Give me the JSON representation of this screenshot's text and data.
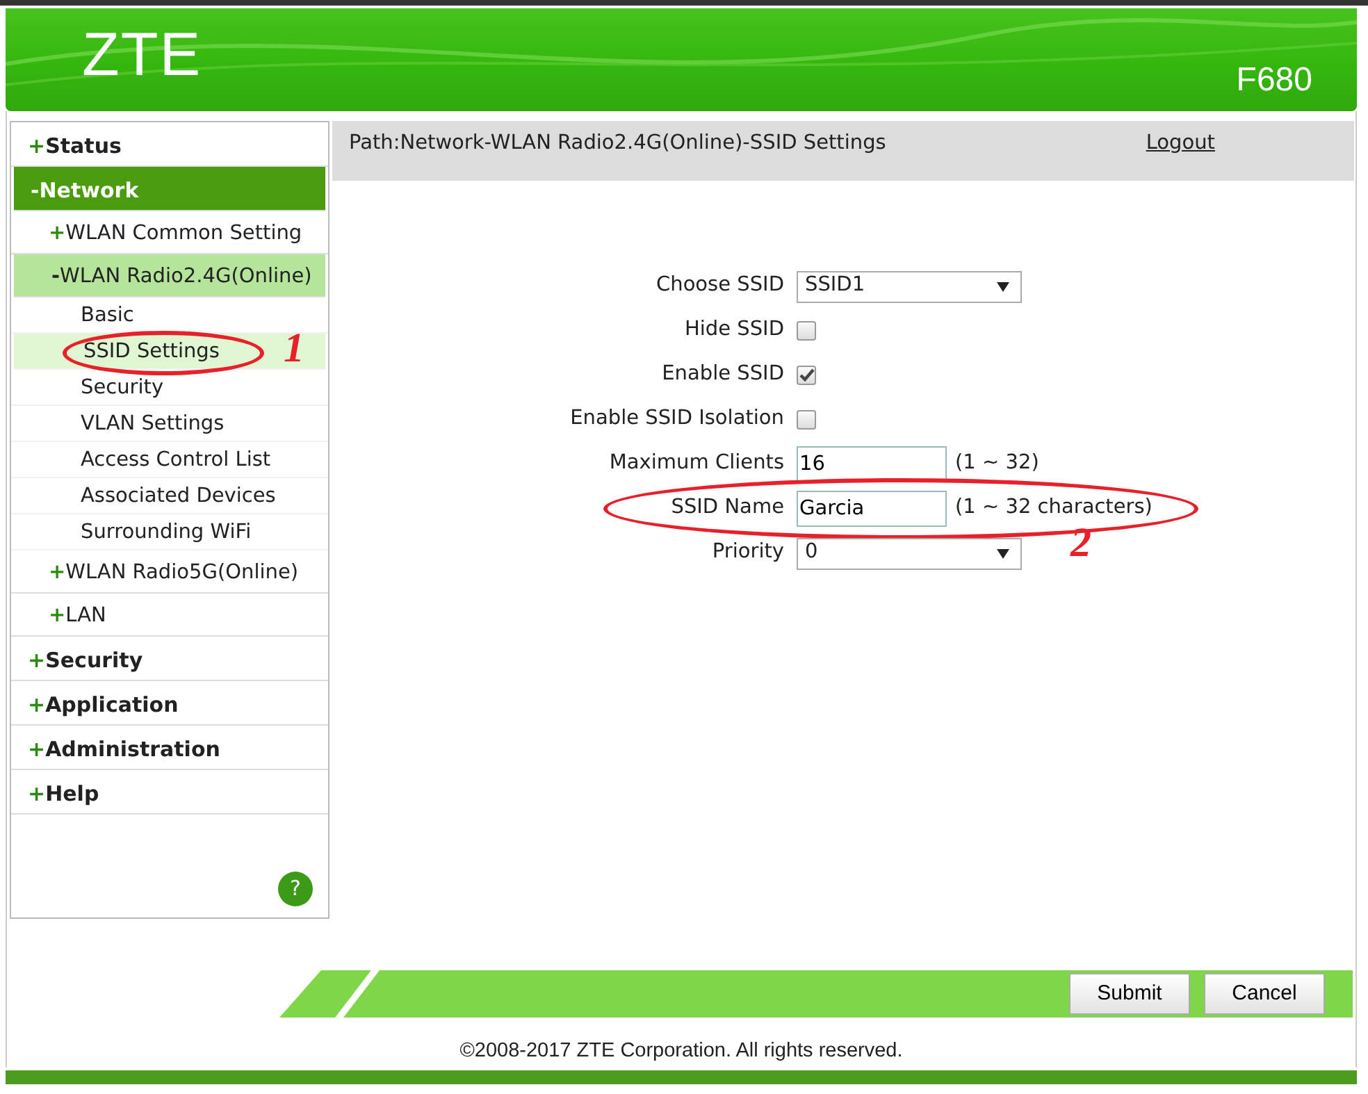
{
  "header": {
    "logo": "ZTE",
    "model": "F680"
  },
  "menu": [
    {
      "toggle": "+",
      "label": "Status",
      "selected": false
    },
    {
      "toggle": "-",
      "label": "Network",
      "selected": true,
      "children": [
        {
          "toggle": "+",
          "label": "WLAN Common Setting",
          "selected": false
        },
        {
          "toggle": "-",
          "label": "WLAN Radio2.4G(Online)",
          "selected": true,
          "children": [
            {
              "label": "Basic",
              "selected": false
            },
            {
              "label": "SSID Settings",
              "selected": true,
              "circled": true,
              "annotation": "1"
            },
            {
              "label": "Security",
              "selected": false
            },
            {
              "label": "VLAN Settings",
              "selected": false
            },
            {
              "label": "Access Control List",
              "selected": false
            },
            {
              "label": "Associated Devices",
              "selected": false
            },
            {
              "label": "Surrounding WiFi",
              "selected": false
            }
          ]
        },
        {
          "toggle": "+",
          "label": "WLAN Radio5G(Online)",
          "selected": false
        },
        {
          "toggle": "+",
          "label": "LAN",
          "selected": false
        }
      ]
    },
    {
      "toggle": "+",
      "label": "Security",
      "selected": false
    },
    {
      "toggle": "+",
      "label": "Application",
      "selected": false
    },
    {
      "toggle": "+",
      "label": "Administration",
      "selected": false
    },
    {
      "toggle": "+",
      "label": "Help",
      "selected": false
    }
  ],
  "help_button": "?",
  "path": "Path:Network-WLAN Radio2.4G(Online)-SSID Settings",
  "logout": "Logout",
  "form": [
    {
      "kind": "select",
      "label": "Choose SSID",
      "value": "SSID1"
    },
    {
      "kind": "checkbox",
      "label": "Hide SSID",
      "checked": false
    },
    {
      "kind": "checkbox",
      "label": "Enable SSID",
      "checked": true
    },
    {
      "kind": "checkbox",
      "label": "Enable SSID Isolation",
      "checked": false
    },
    {
      "kind": "text",
      "label": "Maximum Clients",
      "value": "16",
      "hint": "(1 ~ 32)"
    },
    {
      "kind": "text",
      "label": "SSID Name",
      "value": "Garcia",
      "hint": "(1 ~ 32 characters)",
      "circled": true,
      "annotation": "2"
    },
    {
      "kind": "select",
      "label": "Priority",
      "value": "0"
    }
  ],
  "buttons": [
    "Submit",
    "Cancel"
  ],
  "copyright": "©2008-2017 ZTE Corporation. All rights reserved."
}
